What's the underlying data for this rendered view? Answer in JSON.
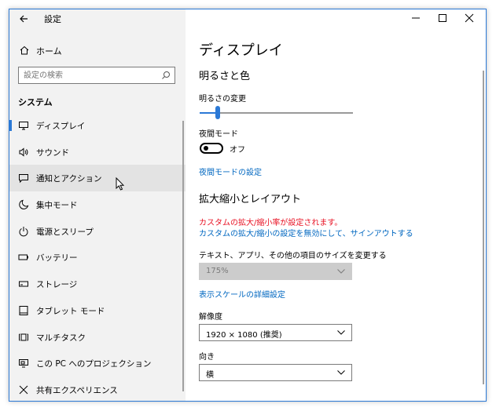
{
  "window": {
    "title": "設定"
  },
  "sidebar": {
    "home": "ホーム",
    "search_placeholder": "設定の検索",
    "section": "システム",
    "items": [
      {
        "label": "ディスプレイ",
        "icon": "monitor-icon",
        "selected": true
      },
      {
        "label": "サウンド",
        "icon": "speaker-icon"
      },
      {
        "label": "通知とアクション",
        "icon": "notification-icon",
        "hover": true
      },
      {
        "label": "集中モード",
        "icon": "moon-icon"
      },
      {
        "label": "電源とスリープ",
        "icon": "power-icon"
      },
      {
        "label": "バッテリー",
        "icon": "battery-icon"
      },
      {
        "label": "ストレージ",
        "icon": "storage-icon"
      },
      {
        "label": "タブレット モード",
        "icon": "tablet-icon"
      },
      {
        "label": "マルチタスク",
        "icon": "multitask-icon"
      },
      {
        "label": "この PC へのプロジェクション",
        "icon": "projection-icon"
      },
      {
        "label": "共有エクスペリエンス",
        "icon": "shared-icon"
      }
    ]
  },
  "content": {
    "page_title": "ディスプレイ",
    "brightness_section": "明るさと色",
    "brightness_label": "明るさの変更",
    "brightness_level": 0.12,
    "night_label": "夜間モード",
    "night_toggle": "オフ",
    "night_link": "夜間モードの設定",
    "scale_section": "拡大縮小とレイアウト",
    "warning": "カスタムの拡大/縮小率が設定されます。",
    "disable_link": "カスタムの拡大/縮小の設定を無効にして、サインアウトする",
    "size_label": "テキスト、アプリ、その他の項目のサイズを変更する",
    "size_value": "175%",
    "advanced_link": "表示スケールの詳細設定",
    "resolution_label": "解像度",
    "resolution_value": "1920 × 1080 (推奨)",
    "orientation_label": "向き",
    "orientation_value": "横"
  },
  "colors": {
    "accent": "#2b79d6",
    "link": "#0067c0",
    "warning": "#e81123",
    "sidebar_bg": "#f2f2f2"
  }
}
